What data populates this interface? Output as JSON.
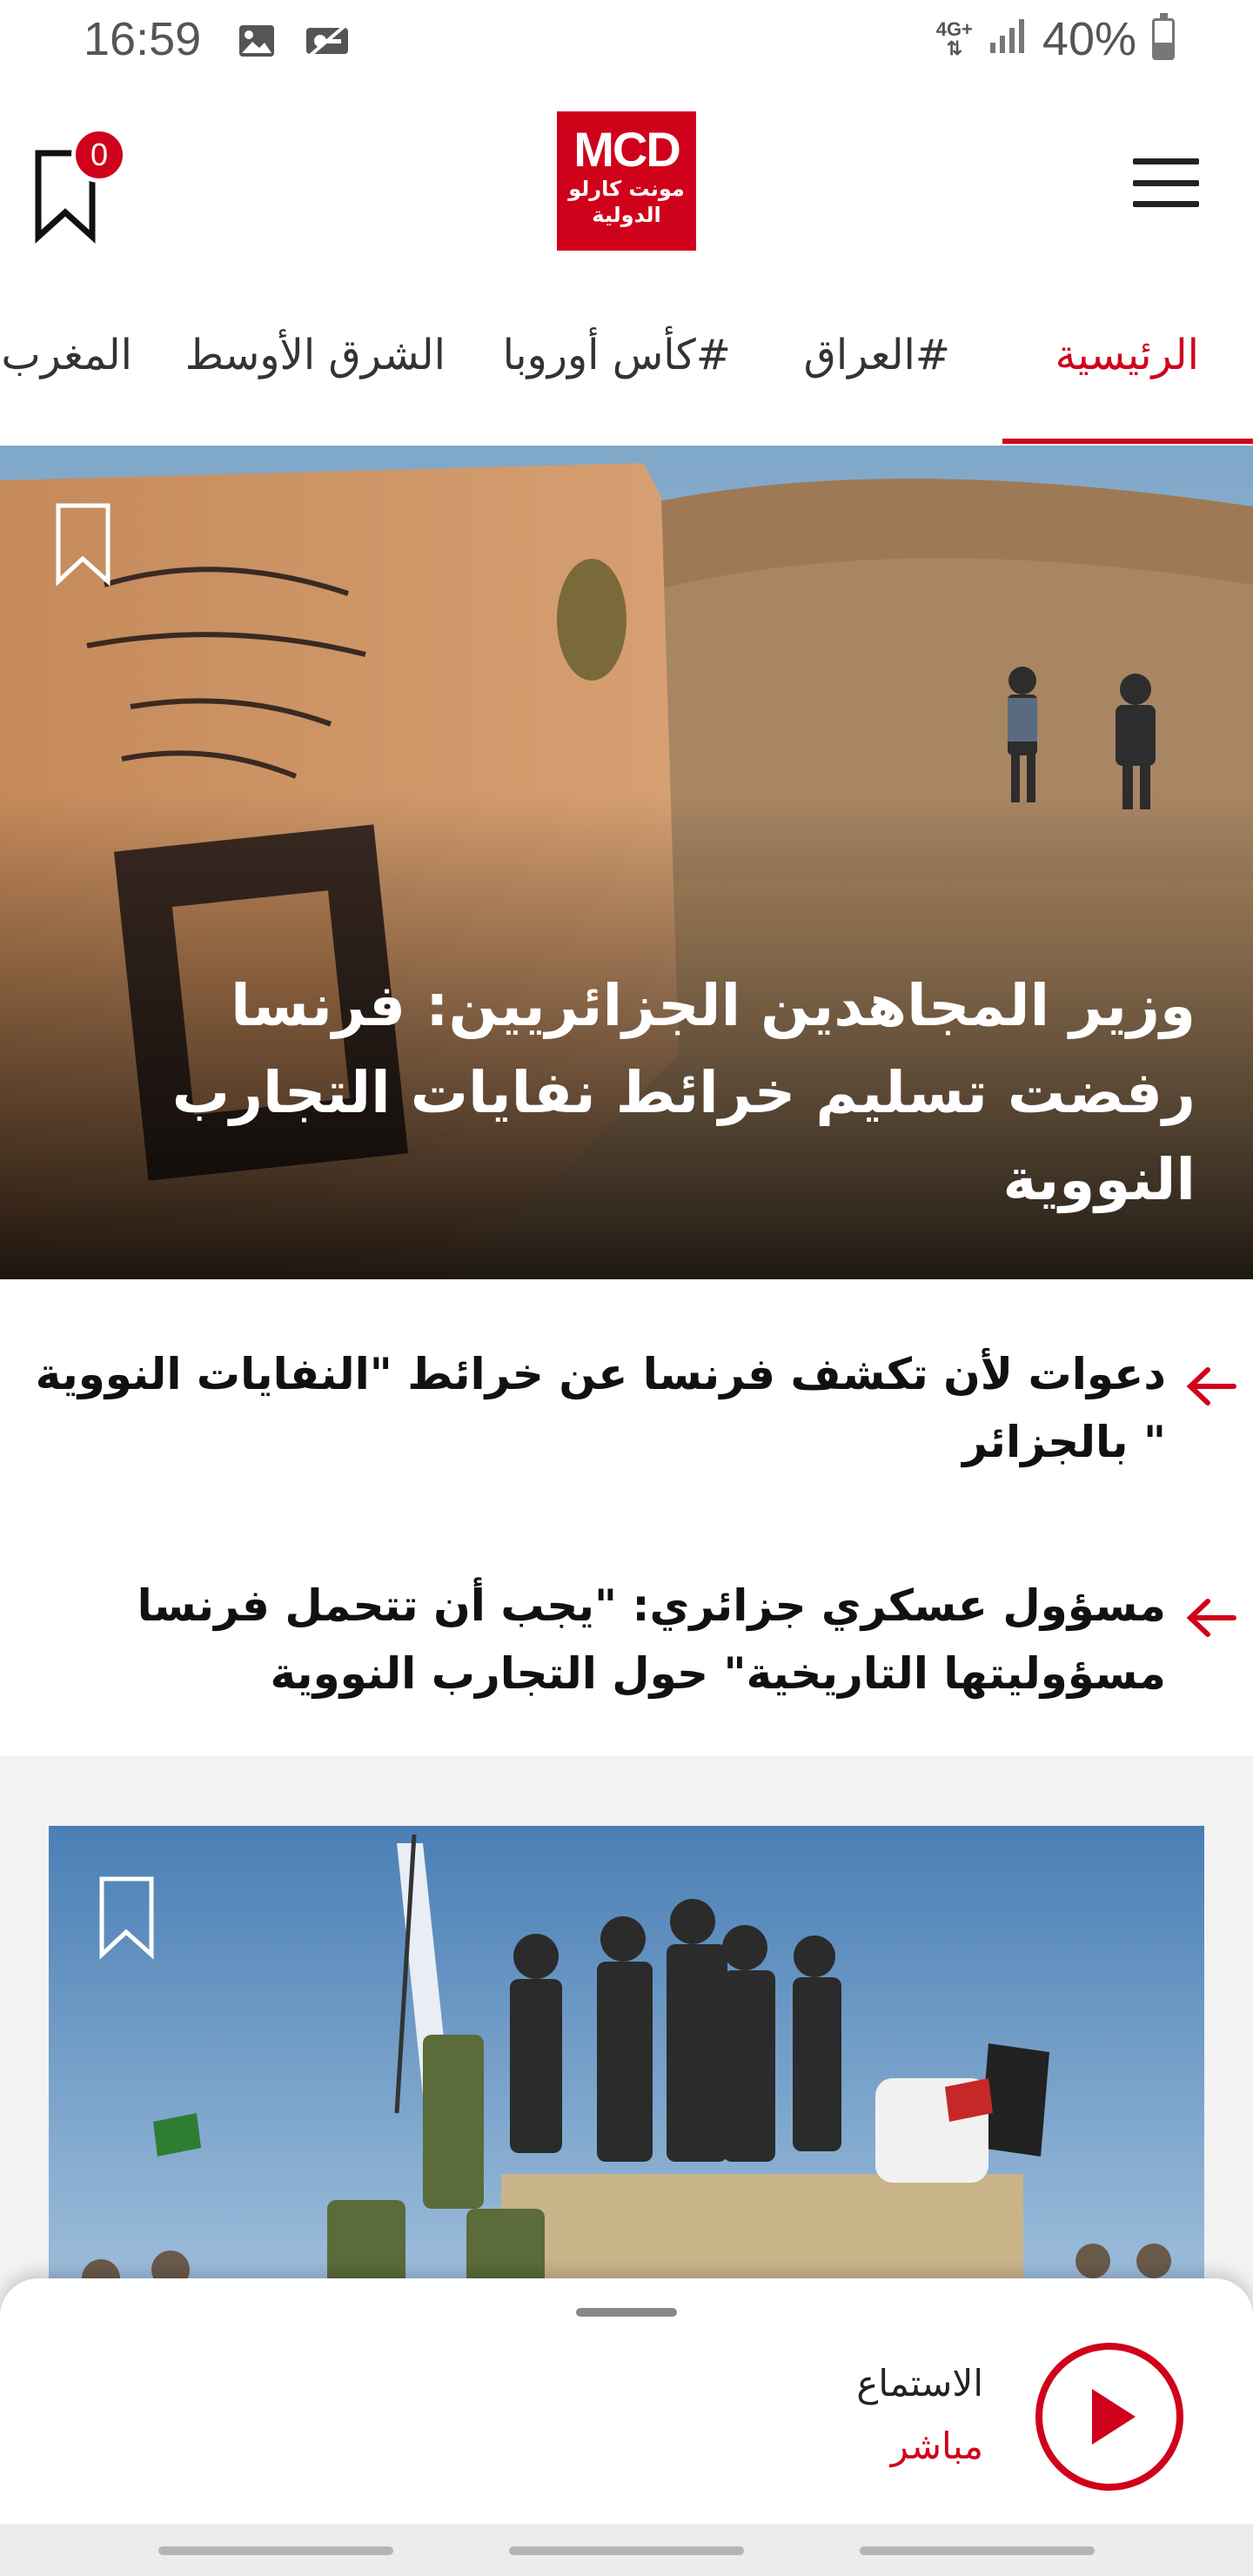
{
  "status_bar": {
    "time": "16:59",
    "network": "4G+",
    "battery": "40%",
    "battery_level": 0.4,
    "icons": [
      "image-icon",
      "vpn-key-icon",
      "signal-icon",
      "battery-icon"
    ]
  },
  "header": {
    "bookmark_count": "0",
    "logo_main": "MCD",
    "logo_sub_line1": "مونت كارلو",
    "logo_sub_line2": "الدولية",
    "brand_color": "#d0021b"
  },
  "tabs": [
    {
      "label": "الرئيسية",
      "active": true
    },
    {
      "label": "#العراق",
      "active": false
    },
    {
      "label": "#كأس أوروبا",
      "active": false
    },
    {
      "label": "الشرق الأوسط",
      "active": false
    },
    {
      "label": "المغرب",
      "active": false
    }
  ],
  "hero": {
    "title": "وزير المجاهدين الجزائريين: فرنسا رفضت تسليم خرائط نفايات التجارب النووية"
  },
  "related": [
    {
      "text": "دعوات لأن تكشف فرنسا عن خرائط \"النفايات النووية \" بالجزائر"
    },
    {
      "text": "مسؤول عسكري جزائري: \"يجب أن تتحمل فرنسا مسؤوليتها التاريخية\" حول التجارب النووية"
    }
  ],
  "player": {
    "label": "الاستماع",
    "sub_label": "مباشر"
  }
}
